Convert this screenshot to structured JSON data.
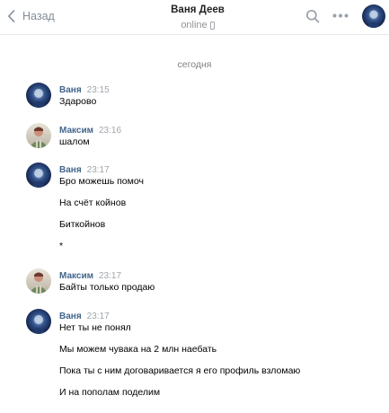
{
  "header": {
    "back_label": "Назад",
    "title": "Ваня Деев",
    "status": "online"
  },
  "icons": {
    "back": "chevron-left-icon",
    "status": "mobile-phone-icon",
    "search": "search-icon",
    "more": "more-dots-icon"
  },
  "colors": {
    "author_link": "#42648b",
    "meta_gray": "#a0a5ab",
    "divider": "#e7e8ec"
  },
  "chat": {
    "date_separator": "сегодня",
    "groups": [
      {
        "author": "Ваня",
        "time": "23:15",
        "messages": [
          "Здарово"
        ]
      },
      {
        "author": "Максим",
        "time": "23:16",
        "messages": [
          "шалом"
        ]
      },
      {
        "author": "Ваня",
        "time": "23:17",
        "messages": [
          "Бро можешь помоч",
          "На счёт койнов",
          "Биткойнов",
          "*"
        ]
      },
      {
        "author": "Максим",
        "time": "23:17",
        "messages": [
          "Байты только продаю"
        ]
      },
      {
        "author": "Ваня",
        "time": "23:17",
        "messages": [
          "Нет ты не понял",
          "Мы можем чувака на 2 млн наебать",
          "Пока ты с ним договаривается я его профиль взломаю",
          "И на пополам поделим"
        ]
      }
    ]
  }
}
